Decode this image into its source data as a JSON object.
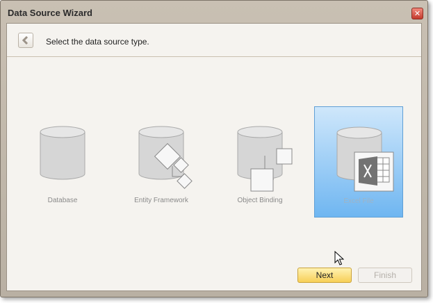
{
  "window": {
    "title": "Data Source Wizard",
    "close_glyph": "✕"
  },
  "header": {
    "instruction": "Select the data source type."
  },
  "tiles": [
    {
      "label": "Database",
      "icon": "database-icon"
    },
    {
      "label": "Entity Framework",
      "icon": "entity-framework-icon"
    },
    {
      "label": "Object Binding",
      "icon": "object-binding-icon"
    },
    {
      "label": "Excel File",
      "icon": "excel-file-icon",
      "selected": true
    }
  ],
  "buttons": {
    "next": "Next",
    "finish": "Finish"
  },
  "colors": {
    "selected_tile_top": "#cfe7fb",
    "selected_tile_bottom": "#6fb6f1",
    "next_button": "#f7cf57"
  }
}
